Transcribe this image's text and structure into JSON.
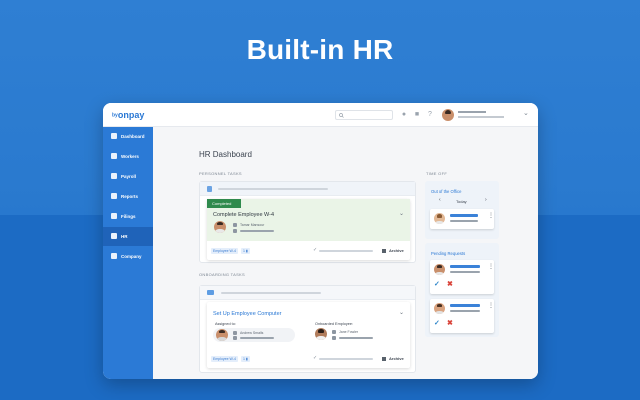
{
  "hero": {
    "title": "Built-in HR"
  },
  "app": {
    "logo": "onpay",
    "logo_prefix": "by"
  },
  "topbar": {
    "search_placeholder": "",
    "icons": [
      "bell-icon",
      "store-icon",
      "help-icon"
    ]
  },
  "sidebar": {
    "items": [
      {
        "label": "Dashboard",
        "icon": "grid-icon"
      },
      {
        "label": "Workers",
        "icon": "person-icon"
      },
      {
        "label": "Payroll",
        "icon": "payroll-icon"
      },
      {
        "label": "Reports",
        "icon": "report-icon"
      },
      {
        "label": "Filings",
        "icon": "filings-icon"
      },
      {
        "label": "HR",
        "icon": "hr-icon"
      },
      {
        "label": "Company",
        "icon": "company-icon"
      }
    ],
    "active": "HR"
  },
  "main": {
    "title": "HR Dashboard",
    "personnel_label": "PERSONNEL TASKS",
    "onboarding_label": "ONBOARDING TASKS",
    "task1": {
      "status": "Completed",
      "title": "Complete Employee W-4",
      "person_name": "Tamar Mansour",
      "chip": "Employee W-4",
      "chip_count": "1",
      "archive": "Archive"
    },
    "task2": {
      "title": "Set Up Employee Computer",
      "assigned_label": "Assigned to:",
      "assigned_name": "Andrew Smalls",
      "onboarded_label": "Onboarded Employee:",
      "onboarded_name": "Jane Fowler",
      "chip": "Employee W-4",
      "chip_count": "1",
      "archive": "Archive"
    }
  },
  "time_off": {
    "label": "TIME OFF",
    "out_title": "Out of the Office",
    "today": "Today",
    "pending_title": "Pending Requests"
  },
  "colors": {
    "brand": "#2b7ad6",
    "completed": "#2f8a4d",
    "deny": "#d9443a"
  }
}
